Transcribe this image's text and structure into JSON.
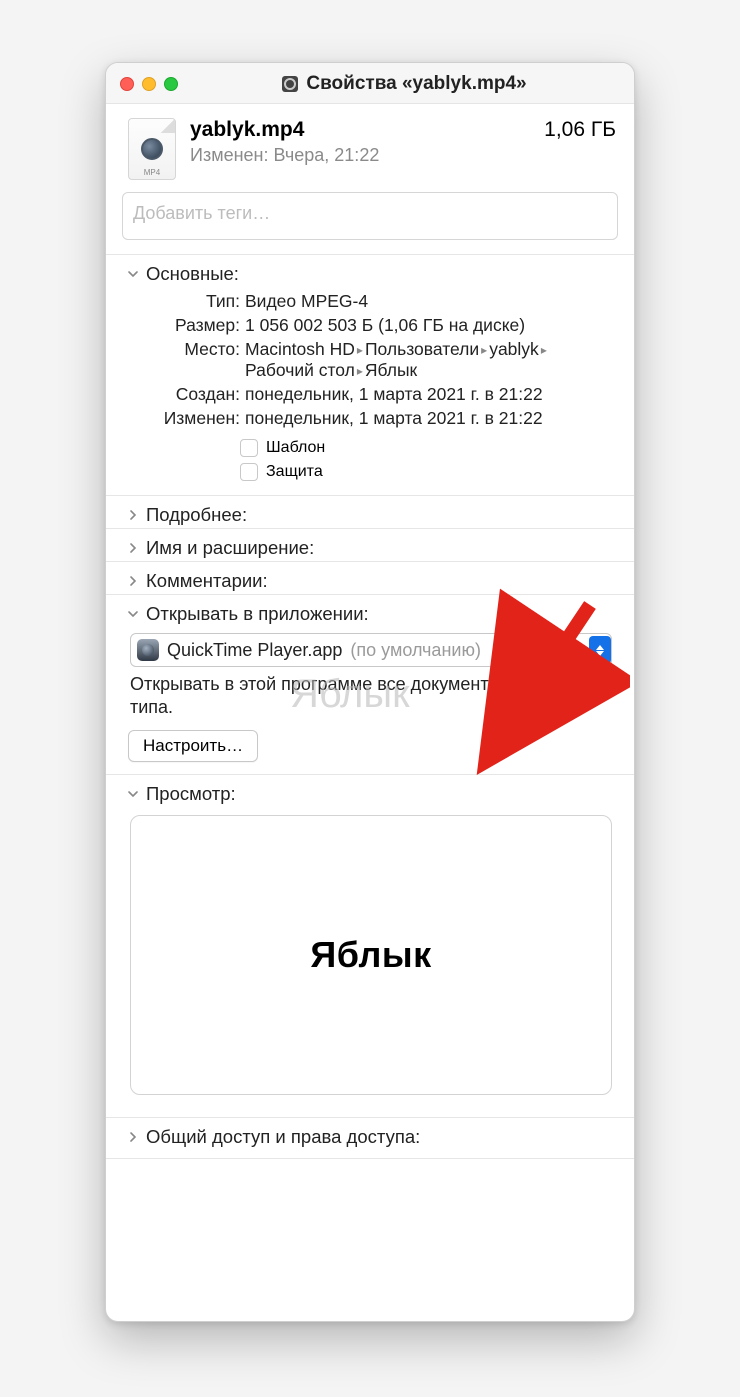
{
  "window": {
    "title": "Свойства «yablyk.mp4»"
  },
  "file": {
    "name": "yablyk.mp4",
    "modified_short": "Изменен: Вчера, 21:22",
    "size": "1,06 ГБ",
    "ext_badge": "MP4"
  },
  "tags": {
    "placeholder": "Добавить теги…"
  },
  "sections": {
    "general": {
      "title": "Основные:",
      "kind_label": "Тип:",
      "kind": "Видео MPEG-4",
      "size_label": "Размер:",
      "size": "1 056 002 503 Б (1,06 ГБ на диске)",
      "where_label": "Место:",
      "where_path": [
        "Macintosh HD",
        "Пользователи",
        "yablyk",
        "Рабочий стол",
        "Яблык"
      ],
      "created_label": "Создан:",
      "created": "понедельник, 1 марта 2021 г. в 21:22",
      "modified_label": "Изменен:",
      "modified": "понедельник, 1 марта 2021 г. в 21:22",
      "template_label": "Шаблон",
      "locked_label": "Защита"
    },
    "more": {
      "title": "Подробнее:"
    },
    "name_ext": {
      "title": "Имя и расширение:"
    },
    "comments": {
      "title": "Комментарии:"
    },
    "open_with": {
      "title": "Открывать в приложении:",
      "app": "QuickTime Player.app",
      "default_suffix": "(по умолчанию)",
      "description": "Открывать в этой программе все документы данного типа.",
      "change_all": "Настроить…"
    },
    "preview": {
      "title": "Просмотр:",
      "content_text": "Яблык"
    },
    "sharing": {
      "title": "Общий доступ и права доступа:"
    }
  },
  "watermark": "Яблык"
}
